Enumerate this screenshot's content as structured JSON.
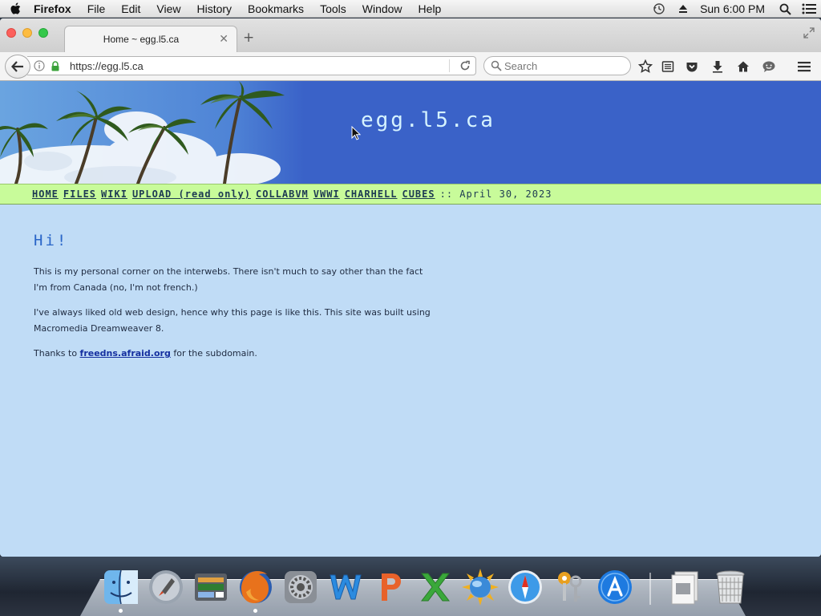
{
  "menubar": {
    "app_name": "Firefox",
    "items": [
      "File",
      "Edit",
      "View",
      "History",
      "Bookmarks",
      "Tools",
      "Window",
      "Help"
    ],
    "clock": "Sun 6:00 PM"
  },
  "browser": {
    "tab_title": "Home ~ egg.l5.ca",
    "url": "https://egg.l5.ca",
    "search_placeholder": "Search"
  },
  "page": {
    "site_title": "egg.l5.ca",
    "nav": {
      "links": [
        "HOME",
        "FILES",
        "WIKI",
        "UPLOAD (read only)",
        "COLLABVM",
        "VWWI",
        "CHARHELL",
        "CUBES"
      ],
      "date": ":: April 30, 2023"
    },
    "heading": "Hi!",
    "paragraph_1": "This is my personal corner on the interwebs. There isn't much to say other than the fact I'm from Canada (no, I'm not french.)",
    "paragraph_2": "I've always liked old web design, hence why this page is like this. This site was built using Macromedia Dreamweaver 8.",
    "paragraph_3_before": "Thanks to ",
    "paragraph_3_link": "freedns.afraid.org",
    "paragraph_3_after": " for the subdomain."
  },
  "colors": {
    "banner_blue": "#3a62c8",
    "nav_green": "#c8fb9a",
    "page_background": "#c0dcf6",
    "heading_blue": "#2a66c8",
    "site_title": "#d6f3ff"
  },
  "dock": {
    "items": [
      "finder-icon",
      "launchpad-icon",
      "photo-app-icon",
      "firefox-icon",
      "system-preferences-icon",
      "word-icon",
      "powerpoint-icon",
      "excel-icon",
      "sun-app-icon",
      "safari-icon",
      "keychain-icon",
      "app-store-icon",
      "documents-stack-icon",
      "trash-icon"
    ]
  }
}
